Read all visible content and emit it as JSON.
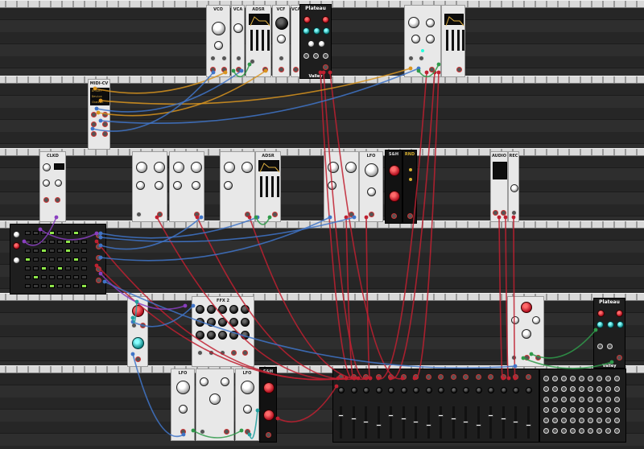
{
  "modules": {
    "vco": "VCO",
    "vca": "VCA",
    "adsr": "ADSR",
    "vcf": "VCF",
    "plateau": "Plateau",
    "valley": "Valley",
    "midicv": "MIDI-CV",
    "clkd": "CLKD",
    "lfo": "LFO",
    "audio": "AUDIO",
    "rec": "REC",
    "sh": "S&H",
    "fx2": "FFX 2",
    "rnd": "RND"
  },
  "midi_screen": [
    "Driver",
    "Device",
    "Channel"
  ],
  "cable_colors": {
    "red": "#c02030",
    "blue": "#3f74c8",
    "orange": "#d8941e",
    "green": "#2f9a4a",
    "purple": "#8a3fc0",
    "teal": "#22a0a0"
  }
}
